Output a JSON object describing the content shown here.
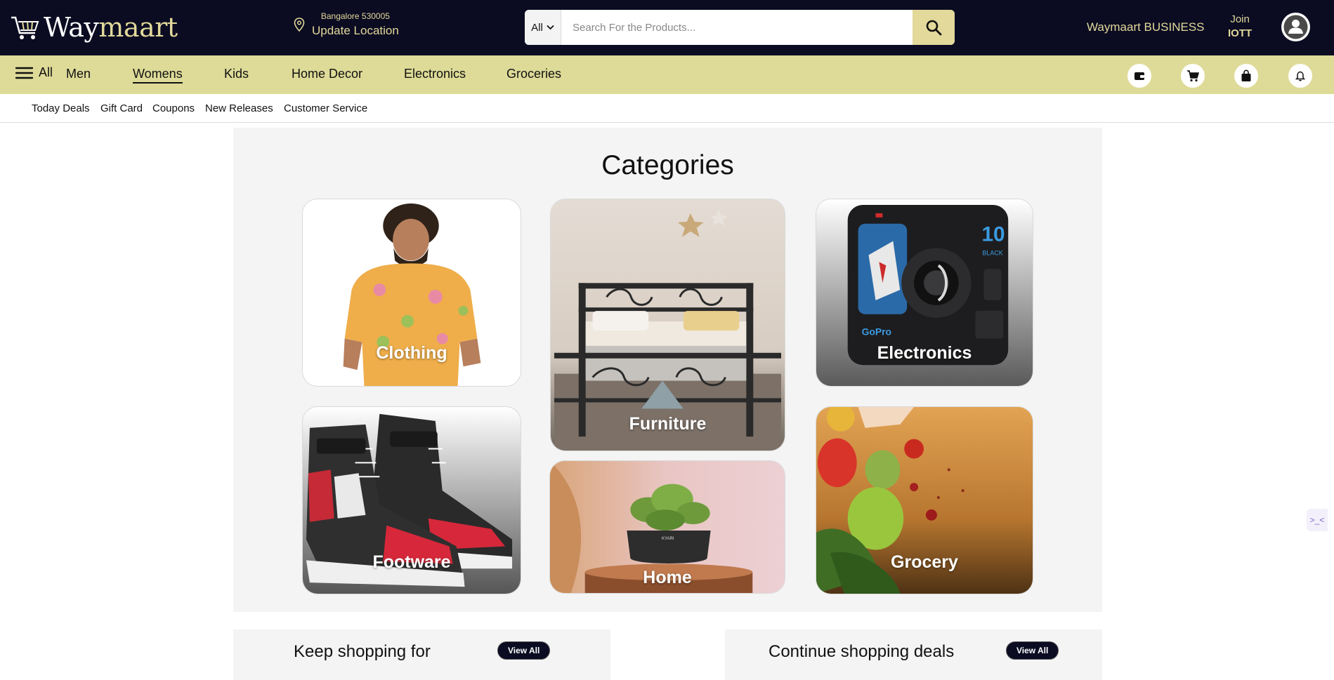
{
  "header": {
    "logo_way": "Way",
    "logo_maart": "maart",
    "location_line1": "Bangalore 530005",
    "location_line2": "Update Location",
    "search_category": "All",
    "search_placeholder": "Search For the Products...",
    "business_link": "Waymaart BUSINESS",
    "join_line1": "Join",
    "join_line2": "IOTT"
  },
  "navbar": {
    "all_label": "All",
    "items": [
      "Men",
      "Womens",
      "Kids",
      "Home Decor",
      "Electronics",
      "Groceries"
    ],
    "active_item": "Womens",
    "icons": [
      "wallet-icon",
      "cart-icon",
      "bag-icon",
      "bell-icon"
    ]
  },
  "subnav": {
    "items": [
      "Today Deals",
      "Gift Card",
      "Coupons",
      "New Releases",
      "Customer Service"
    ]
  },
  "categories": {
    "title": "Categories",
    "tiles": [
      "Clothing",
      "Furniture",
      "Electronics",
      "Footware",
      "Home",
      "Grocery"
    ]
  },
  "sections": {
    "keep_shopping_title": "Keep shopping for",
    "keep_shopping_button": "View All",
    "continue_title": "Continue shopping deals",
    "continue_button": "View All"
  },
  "side_widget": ">_<",
  "colors": {
    "header_bg": "#0b0b22",
    "accent": "#e2d99a",
    "navbar_bg": "#dedb98",
    "panel_bg": "#f4f4f4"
  }
}
